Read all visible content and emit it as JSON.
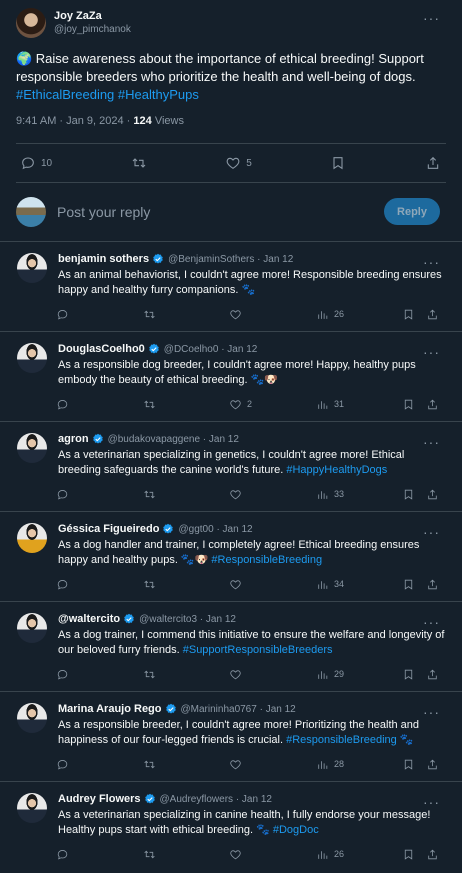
{
  "main_tweet": {
    "author_name": "Joy ZaZa",
    "author_handle": "@joy_pimchanok",
    "text_lead": "🌍 Raise awareness about the importance of ethical breeding! Support responsible breeders who prioritize the health and well-being of dogs.",
    "hashtags": "#EthicalBreeding #HealthyPups",
    "time": "9:41 AM · Jan 9, 2024 · ",
    "views_count": "124",
    "views_label": " Views",
    "replies": "10",
    "likes": "5",
    "more_icon": "ellipsis-icon"
  },
  "reply_box": {
    "placeholder": "Post your reply",
    "button_label": "Reply"
  },
  "replies": [
    {
      "name": "benjamin sothers",
      "handle_date": "@BenjaminSothers · Jan 12",
      "text": "As an animal behaviorist, I couldn't agree more! Responsible breeding ensures happy and healthy furry companions. 🐾",
      "tag": "",
      "views": "26",
      "likes": ""
    },
    {
      "name": "DouglasCoelho0",
      "handle_date": "@DCoelho0 · Jan 12",
      "text": "As a responsible dog breeder, I couldn't agree more! Happy, healthy pups embody the beauty of ethical breeding. 🐾🐶",
      "tag": "",
      "views": "31",
      "likes": "2"
    },
    {
      "name": "agron",
      "handle_date": "@budakovapaggene · Jan 12",
      "text": "As a veterinarian specializing in genetics, I couldn't agree more! Ethical breeding safeguards the canine world's future. ",
      "tag": "#HappyHealthyDogs",
      "views": "33",
      "likes": ""
    },
    {
      "name": "Géssica Figueiredo",
      "handle_date": "@ggt00 · Jan 12",
      "text": "As a dog handler and trainer, I completely agree! Ethical breeding ensures happy and healthy pups. 🐾🐶 ",
      "tag": "#ResponsibleBreeding",
      "views": "34",
      "likes": ""
    },
    {
      "name": "@waltercito",
      "handle_date": "@waltercito3 · Jan 12",
      "text": "As a dog trainer, I commend this initiative to ensure the welfare and longevity of our beloved furry friends. ",
      "tag": "#SupportResponsibleBreeders",
      "views": "29",
      "likes": ""
    },
    {
      "name": "Marina Araujo Rego",
      "handle_date": "@Marininha0767 · Jan 12",
      "text": "As a responsible breeder, I couldn't agree more! Prioritizing the health and happiness of our four-legged friends is crucial. ",
      "tag": "#ResponsibleBreeding",
      "tag_suffix": " 🐾",
      "views": "28",
      "likes": ""
    },
    {
      "name": "Audrey Flowers",
      "handle_date": "@Audreyflowers · Jan 12",
      "text": "As a veterinarian specializing in canine health, I fully endorse your message! Healthy pups start with ethical breeding. 🐾 ",
      "tag": "#DogDoc",
      "views": "26",
      "likes": ""
    }
  ],
  "colors": {
    "background": "#15202b",
    "accent": "#1d9bf0",
    "muted": "#8b98a5",
    "divider": "#38444d"
  }
}
